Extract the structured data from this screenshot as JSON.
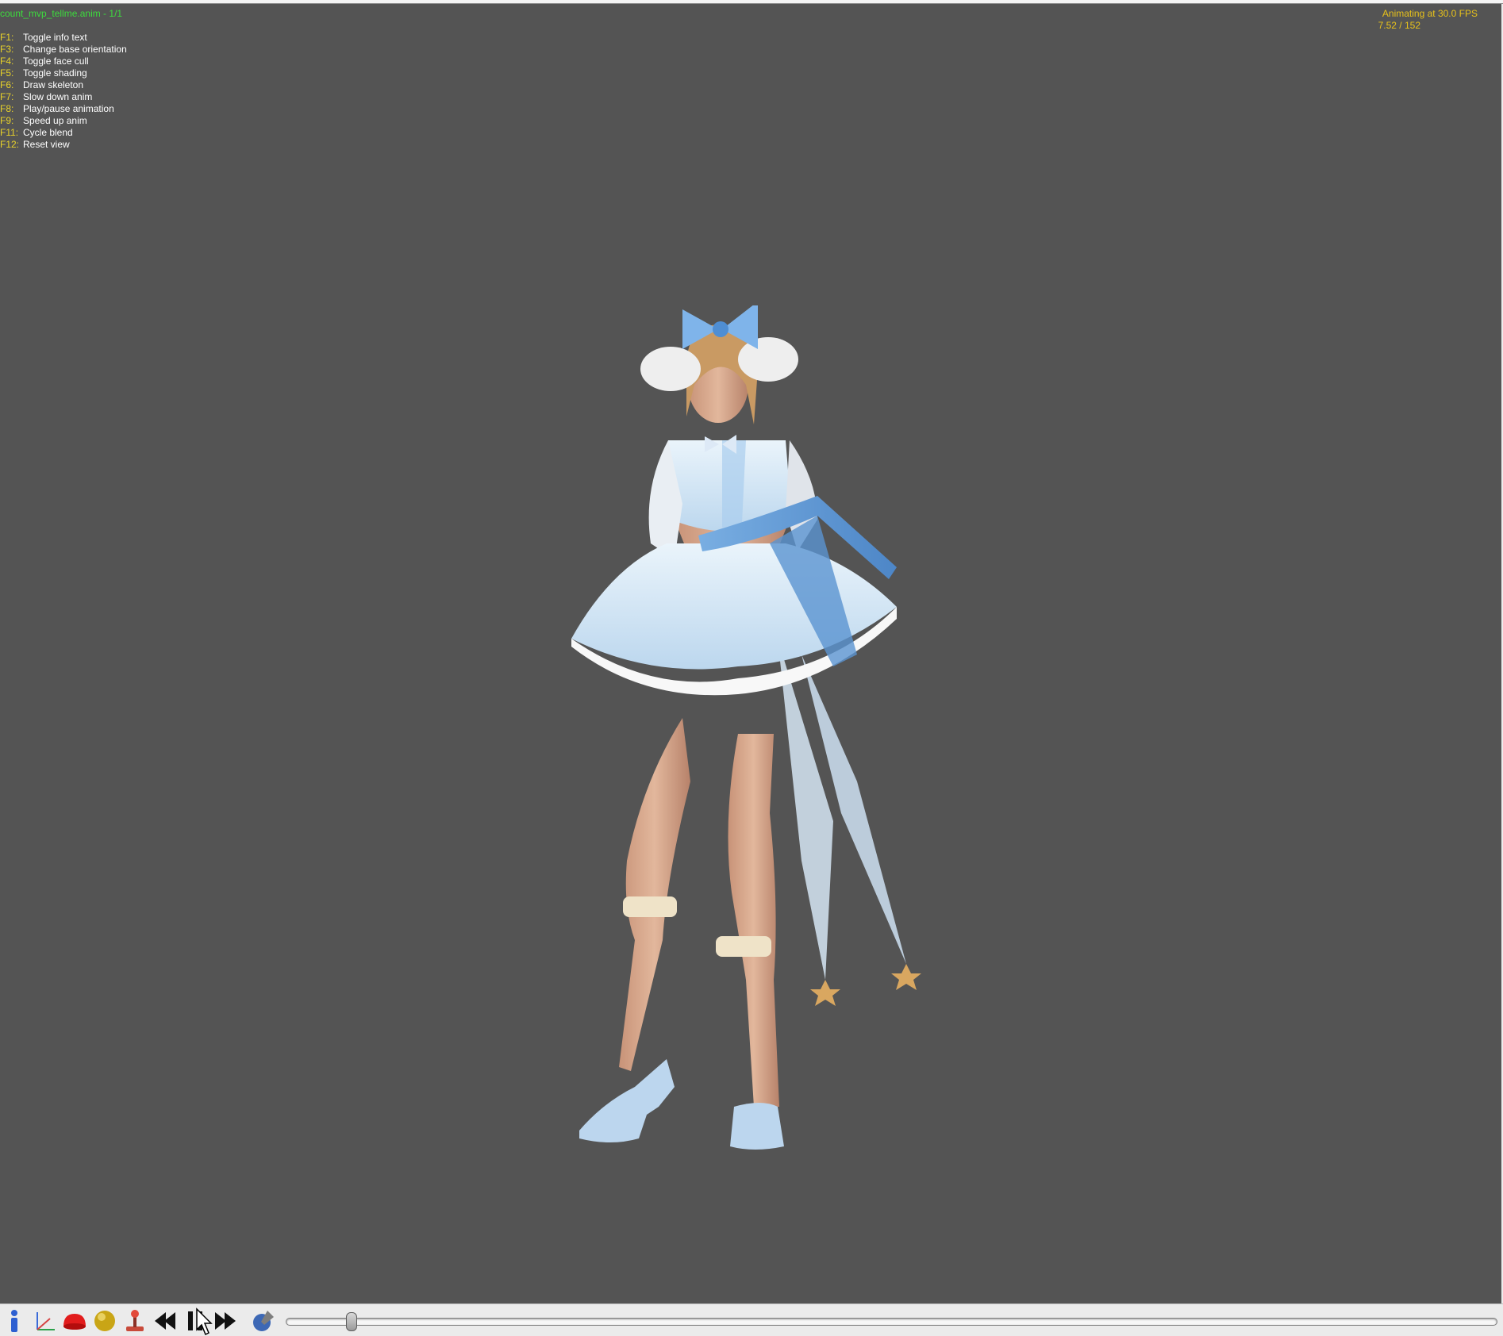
{
  "viewer": {
    "anim_name": "count_mvp_tellme.anim - 1/1",
    "fps_status": "Animating at 30.0 FPS",
    "frame_status": "7.52 / 152",
    "help": [
      {
        "key": "F1:",
        "label": "Toggle info text"
      },
      {
        "key": "F3:",
        "label": "Change base orientation"
      },
      {
        "key": "F4:",
        "label": "Toggle face cull"
      },
      {
        "key": "F5:",
        "label": "Toggle shading"
      },
      {
        "key": "F6:",
        "label": "Draw skeleton"
      },
      {
        "key": "F7:",
        "label": "Slow down anim"
      },
      {
        "key": "F8:",
        "label": "Play/pause animation"
      },
      {
        "key": "F9:",
        "label": "Speed up anim"
      },
      {
        "key": "F11:",
        "label": "Cycle blend"
      },
      {
        "key": "F12:",
        "label": "Reset view"
      }
    ],
    "background_color": "#545454",
    "info_color_green": "#3ddc3d",
    "info_color_yellow": "#e8c21a"
  },
  "toolbar": {
    "buttons": [
      {
        "name": "info-button",
        "icon": "info-icon"
      },
      {
        "name": "axes-button",
        "icon": "axes-icon"
      },
      {
        "name": "hemisphere-button",
        "icon": "hemisphere-icon"
      },
      {
        "name": "sphere-button",
        "icon": "sphere-icon"
      },
      {
        "name": "joystick-button",
        "icon": "joystick-icon"
      },
      {
        "name": "rewind-button",
        "icon": "rewind-icon"
      },
      {
        "name": "pause-button",
        "icon": "pause-icon"
      },
      {
        "name": "fast-forward-button",
        "icon": "fast-forward-icon"
      },
      {
        "name": "globe-button",
        "icon": "globe-icon"
      }
    ],
    "timeline_position": 0.05
  }
}
